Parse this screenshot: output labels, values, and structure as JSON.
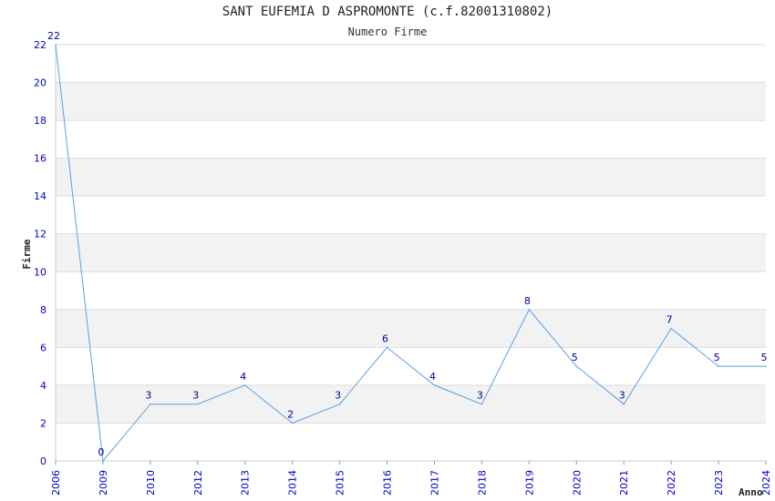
{
  "chart_data": {
    "type": "line",
    "title": "SANT EUFEMIA D ASPROMONTE (c.f.82001310802)",
    "subtitle": "Numero Firme",
    "xlabel": "Anno",
    "ylabel": "Firme",
    "categories": [
      "2006",
      "2009",
      "2010",
      "2012",
      "2013",
      "2014",
      "2015",
      "2016",
      "2017",
      "2018",
      "2019",
      "2020",
      "2021",
      "2022",
      "2023",
      "2024"
    ],
    "values": [
      22,
      0,
      3,
      3,
      4,
      2,
      3,
      6,
      4,
      3,
      8,
      5,
      3,
      7,
      5,
      5
    ],
    "ylim": [
      0,
      22
    ],
    "yticks": [
      0,
      2,
      4,
      6,
      8,
      10,
      12,
      14,
      16,
      18,
      20,
      22
    ],
    "grid": true,
    "colors": {
      "line": "#5aa0e6",
      "band": "#f2f2f2",
      "grid": "#dddddd",
      "tick_text": "#0000cc",
      "data_label": "#000099"
    }
  }
}
